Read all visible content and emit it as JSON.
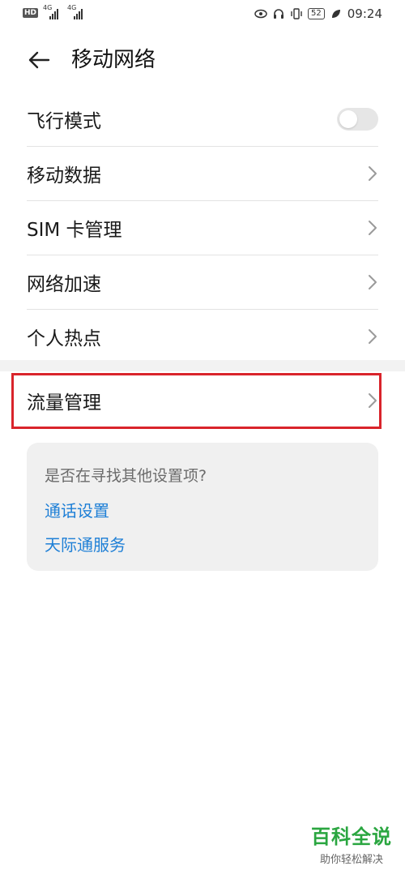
{
  "status_bar": {
    "hd_label": "HD",
    "sim1_label": "4G",
    "sim2_label": "4G",
    "battery_level": "52",
    "time": "09:24",
    "icons": [
      "eye-icon",
      "headphones-icon",
      "vibrate-icon",
      "battery-icon",
      "leaf-icon"
    ]
  },
  "header": {
    "title": "移动网络"
  },
  "list": {
    "items": [
      {
        "label": "飞行模式",
        "type": "toggle",
        "on": false
      },
      {
        "label": "移动数据",
        "type": "chevron"
      },
      {
        "label": "SIM 卡管理",
        "type": "chevron"
      },
      {
        "label": "网络加速",
        "type": "chevron"
      },
      {
        "label": "个人热点",
        "type": "chevron"
      }
    ]
  },
  "traffic": {
    "label": "流量管理"
  },
  "suggestions": {
    "question": "是否在寻找其他设置项?",
    "links": [
      "通话设置",
      "天际通服务"
    ]
  },
  "watermark": {
    "brand": "百科全说",
    "tagline": "助你轻松解决"
  },
  "colors": {
    "accent_link": "#1e7fd6",
    "highlight_border": "#d9242b",
    "watermark_green": "#2aa640"
  }
}
